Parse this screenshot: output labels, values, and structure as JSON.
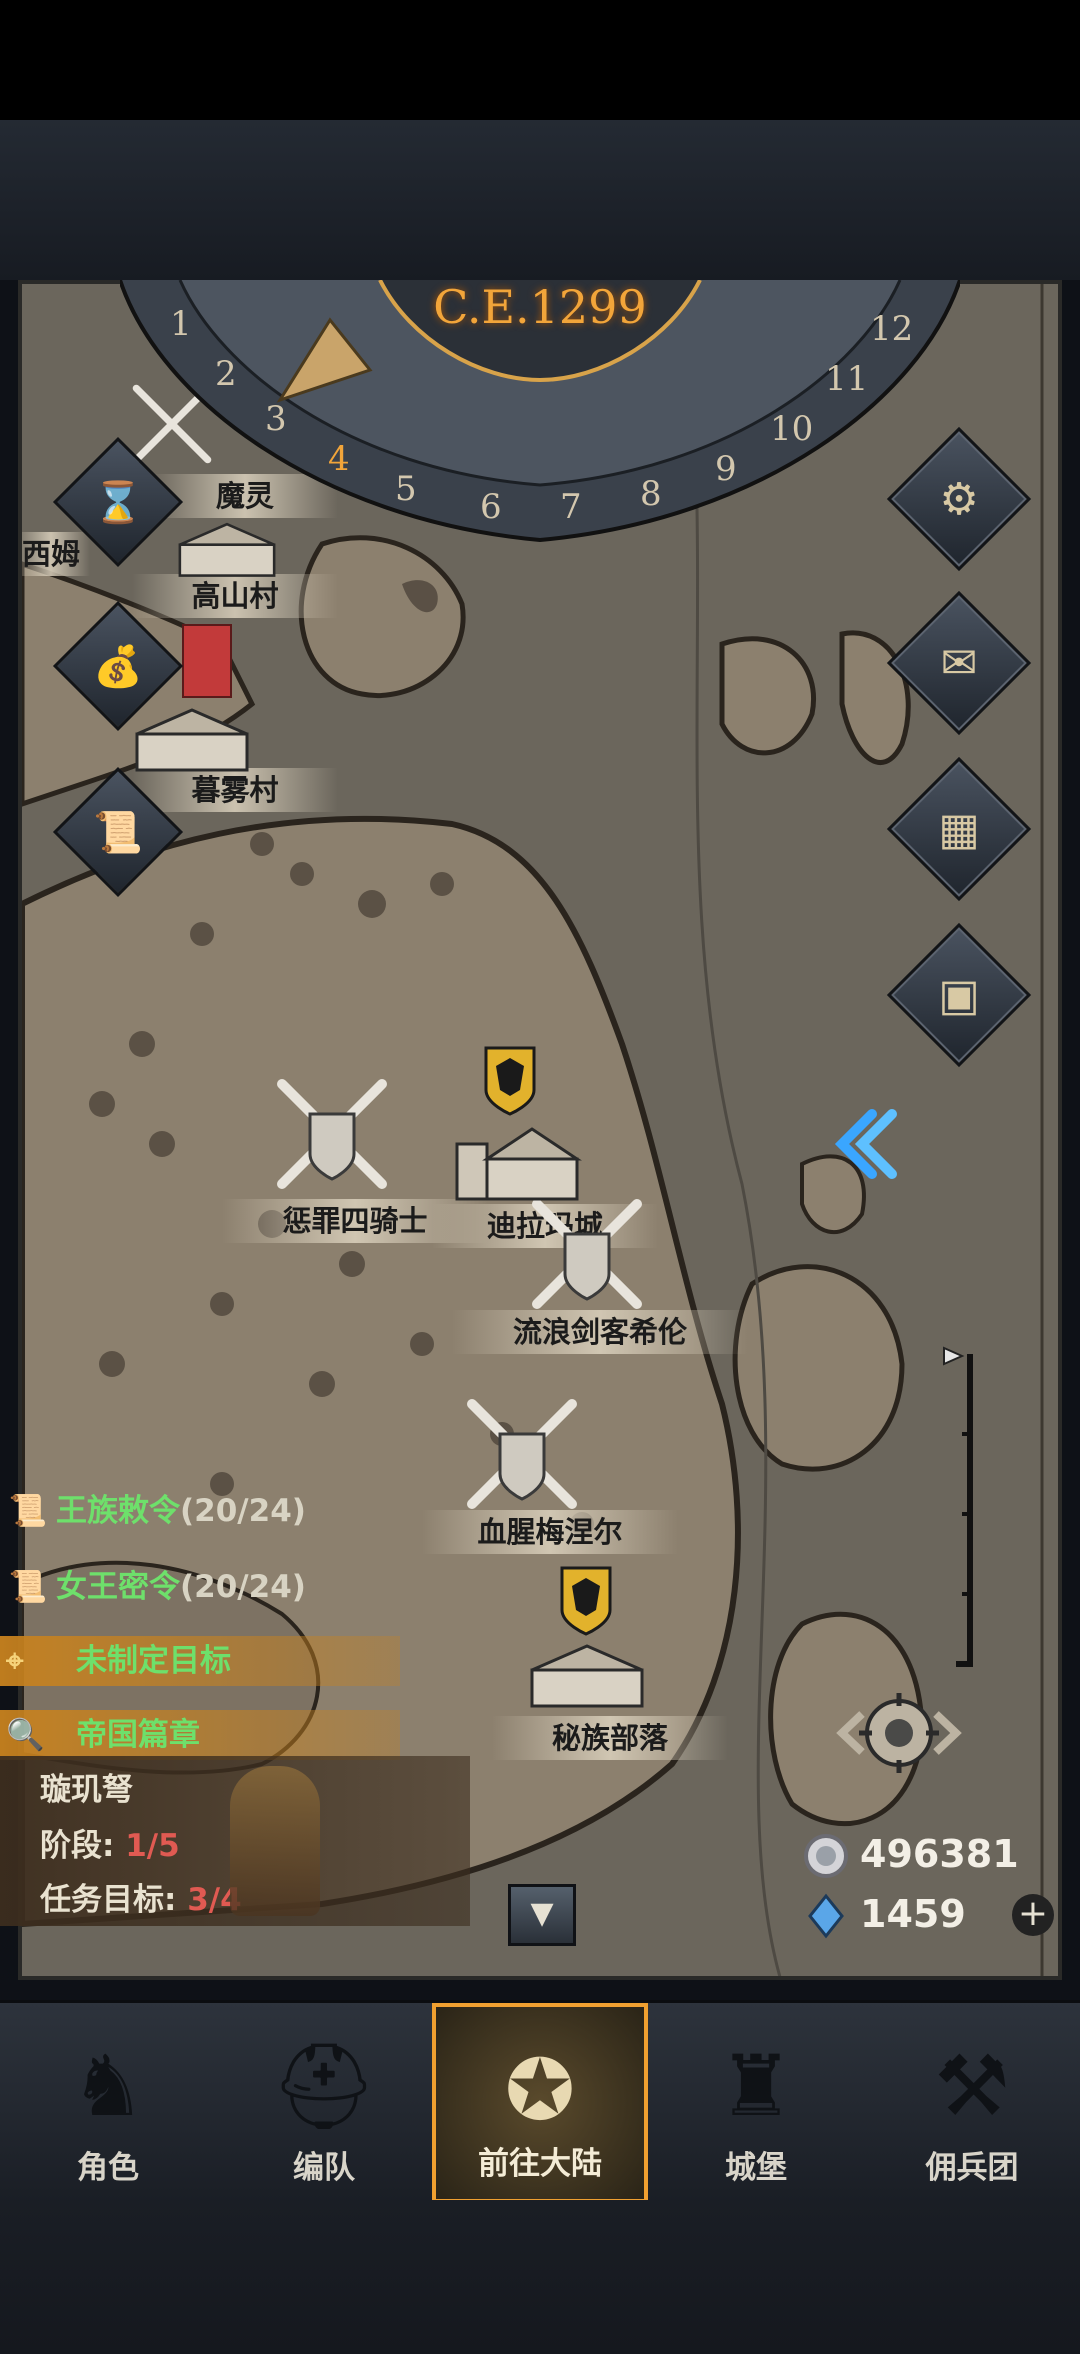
{
  "timeline": {
    "year": "C.E.1299",
    "ticks": [
      "1",
      "2",
      "3",
      "4",
      "5",
      "6",
      "7",
      "8",
      "9",
      "10",
      "11",
      "12"
    ],
    "current_tick": "4"
  },
  "map_labels": {
    "demon_spirit": "魔灵",
    "west": "西姆",
    "high_mountain": "高山村",
    "dark_mist": "暮雾村",
    "four_knights": "惩罪四骑士",
    "dila": "迪拉玛城",
    "wandering_swordsman": "流浪剑客希伦",
    "bloody_mezer": "血腥梅涅尔",
    "secret_tribe": "秘族部落"
  },
  "quests": [
    {
      "name": "王族敕令",
      "count": "(20/24)"
    },
    {
      "name": "女王密令",
      "count": "(20/24)"
    }
  ],
  "goal": "未制定目标",
  "chapter": {
    "title": "帝国篇章",
    "subject": "璇玑弩",
    "stage_label": "阶段:",
    "stage_value": "1/5",
    "task_label": "任务目标:",
    "task_value": "3/4"
  },
  "resources": {
    "silver": "496381",
    "crystal": "1459"
  },
  "nav": [
    {
      "label": "角色",
      "icon": "knight-icon"
    },
    {
      "label": "编队",
      "icon": "helmet-icon"
    },
    {
      "label": "前往大陆",
      "icon": "compass-icon"
    },
    {
      "label": "城堡",
      "icon": "castle-icon"
    },
    {
      "label": "佣兵团",
      "icon": "axe-icon"
    }
  ],
  "colors": {
    "accent": "#f0a030",
    "quest_green": "#6ee06b",
    "progress_red": "#e05a52"
  }
}
